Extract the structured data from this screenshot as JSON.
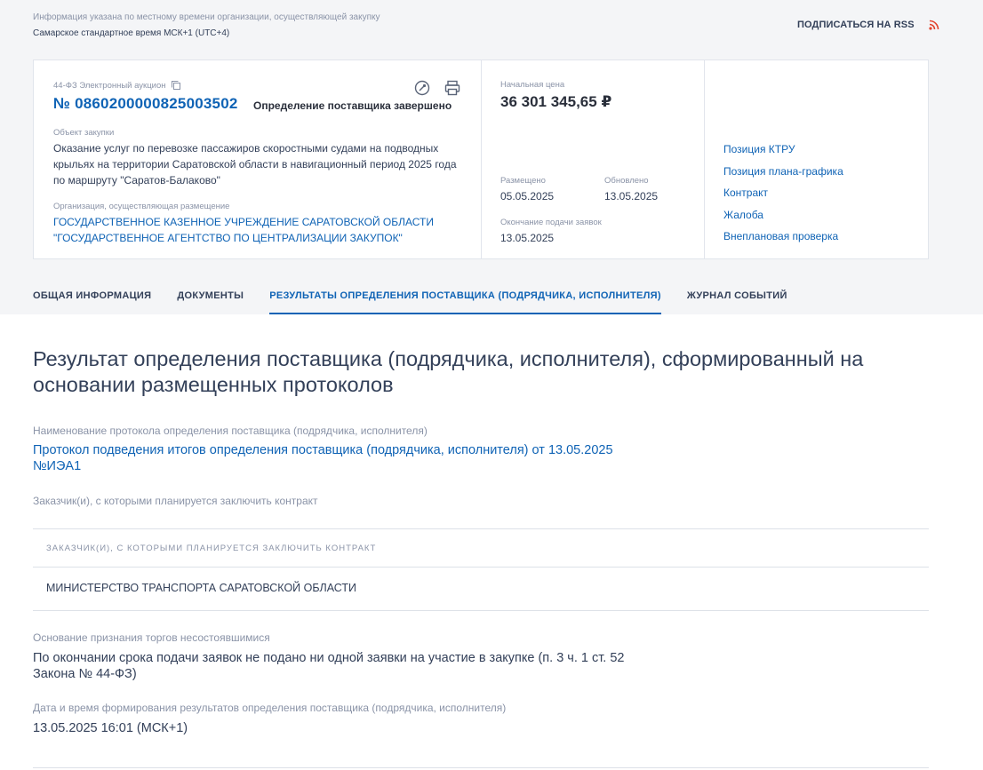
{
  "header": {
    "tz_note": "Информация указана по местному времени организации, осуществляющей закупку",
    "tz_value": "Самарское стандартное время МСК+1 (UTC+4)",
    "rss_label": "ПОДПИСАТЬСЯ НА RSS",
    "rss_icon": "rss-icon"
  },
  "card": {
    "procurement_type": "44-ФЗ Электронный аукцион",
    "number": "№ 0860200000825003502",
    "status": "Определение поставщика завершено",
    "object_label": "Объект закупки",
    "object_text": "Оказание услуг по перевозке пассажиров скоростными судами на подводных крыльях на территории Саратовской области в навигационный период 2025 года по маршруту \"Саратов-Балаково\"",
    "org_label": "Организация, осуществляющая размещение",
    "org_text": "ГОСУДАРСТВЕННОЕ КАЗЕННОЕ УЧРЕЖДЕНИЕ САРАТОВСКОЙ ОБЛАСТИ \"ГОСУДАРСТВЕННОЕ АГЕНТСТВО ПО ЦЕНТРАЛИЗАЦИИ ЗАКУПОК\"",
    "price_label": "Начальная цена",
    "price": "36 301 345,65 ₽",
    "posted_label": "Размещено",
    "posted_value": "05.05.2025",
    "updated_label": "Обновлено",
    "updated_value": "13.05.2025",
    "deadline_label": "Окончание подачи заявок",
    "deadline_value": "13.05.2025",
    "side_links": [
      "Позиция КТРУ",
      "Позиция плана-графика",
      "Контракт",
      "Жалоба",
      "Внеплановая проверка"
    ]
  },
  "tabs": [
    {
      "label": "ОБЩАЯ ИНФОРМАЦИЯ",
      "active": false
    },
    {
      "label": "ДОКУМЕНТЫ",
      "active": false
    },
    {
      "label": "РЕЗУЛЬТАТЫ ОПРЕДЕЛЕНИЯ ПОСТАВЩИКА (ПОДРЯДЧИКА, ИСПОЛНИТЕЛЯ)",
      "active": true
    },
    {
      "label": "ЖУРНАЛ СОБЫТИЙ",
      "active": false
    }
  ],
  "main": {
    "title": "Результат определения поставщика (подрядчика, исполнителя), сформированный на основании размещенных протоколов",
    "protocol_label": "Наименование протокола определения поставщика (подрядчика, исполнителя)",
    "protocol_link": "Протокол подведения итогов определения поставщика (подрядчика, исполнителя) от 13.05.2025 №ИЭА1",
    "customers_label": "Заказчик(и), с которыми планируется заключить контракт",
    "table_header": "ЗАКАЗЧИК(И), С КОТОРЫМИ ПЛАНИРУЕТСЯ ЗАКЛЮЧИТЬ КОНТРАКТ",
    "table_rows": [
      "МИНИСТЕРСТВО ТРАНСПОРТА САРАТОВСКОЙ ОБЛАСТИ"
    ],
    "reason_label": "Основание признания торгов несостоявшимися",
    "reason_text": "По окончании срока подачи заявок не подано ни одной заявки на участие в закупке (п. 3 ч. 1 ст. 52 Закона № 44-ФЗ)",
    "datetime_label": "Дата и время формирования результатов определения поставщика (подрядчика, исполнителя)",
    "datetime_value": "13.05.2025 16:01 (МСК+1)"
  }
}
